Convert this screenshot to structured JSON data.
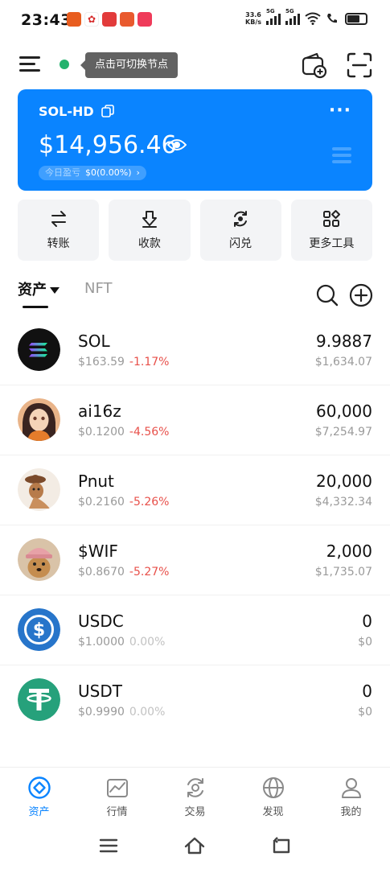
{
  "status_bar": {
    "time": "23:43",
    "net_speed_value": "33.6",
    "net_speed_unit": "KB/s",
    "sim1_tag": "5G",
    "sim2_tag": "5G"
  },
  "header": {
    "node_tooltip": "点击可切换节点",
    "node_status_color": "#23b26d"
  },
  "wallet": {
    "name": "SOL-HD",
    "balance": "$14,956.46",
    "today_pnl_label": "今日盈亏",
    "today_pnl_value": "$0(0.00%)",
    "pnl_arrow": "›",
    "more": "···",
    "card_color": "#0a84ff"
  },
  "actions": [
    {
      "label": "转账",
      "icon": "transfer-icon"
    },
    {
      "label": "收款",
      "icon": "receive-icon"
    },
    {
      "label": "闪兑",
      "icon": "swap-icon"
    },
    {
      "label": "更多工具",
      "icon": "tools-icon"
    }
  ],
  "tabs": {
    "assets": "资产",
    "nft": "NFT"
  },
  "assets": [
    {
      "symbol": "SOL",
      "price": "$163.59",
      "change": "-1.17%",
      "change_type": "neg",
      "amount": "9.9887",
      "value": "$1,634.07"
    },
    {
      "symbol": "ai16z",
      "price": "$0.1200",
      "change": "-4.56%",
      "change_type": "neg",
      "amount": "60,000",
      "value": "$7,254.97"
    },
    {
      "symbol": "Pnut",
      "price": "$0.2160",
      "change": "-5.26%",
      "change_type": "neg",
      "amount": "20,000",
      "value": "$4,332.34"
    },
    {
      "symbol": "$WIF",
      "price": "$0.8670",
      "change": "-5.27%",
      "change_type": "neg",
      "amount": "2,000",
      "value": "$1,735.07"
    },
    {
      "symbol": "USDC",
      "price": "$1.0000",
      "change": "0.00%",
      "change_type": "flat",
      "amount": "0",
      "value": "$0"
    },
    {
      "symbol": "USDT",
      "price": "$0.9990",
      "change": "0.00%",
      "change_type": "flat",
      "amount": "0",
      "value": "$0"
    }
  ],
  "bottom_nav": [
    {
      "label": "资产",
      "icon": "assets-icon",
      "active": true
    },
    {
      "label": "行情",
      "icon": "market-icon",
      "active": false
    },
    {
      "label": "交易",
      "icon": "trade-icon",
      "active": false
    },
    {
      "label": "发现",
      "icon": "discover-icon",
      "active": false
    },
    {
      "label": "我的",
      "icon": "profile-icon",
      "active": false
    }
  ],
  "colors": {
    "accent": "#0a84ff",
    "negative": "#e8504a",
    "muted": "#9a9a9a"
  }
}
